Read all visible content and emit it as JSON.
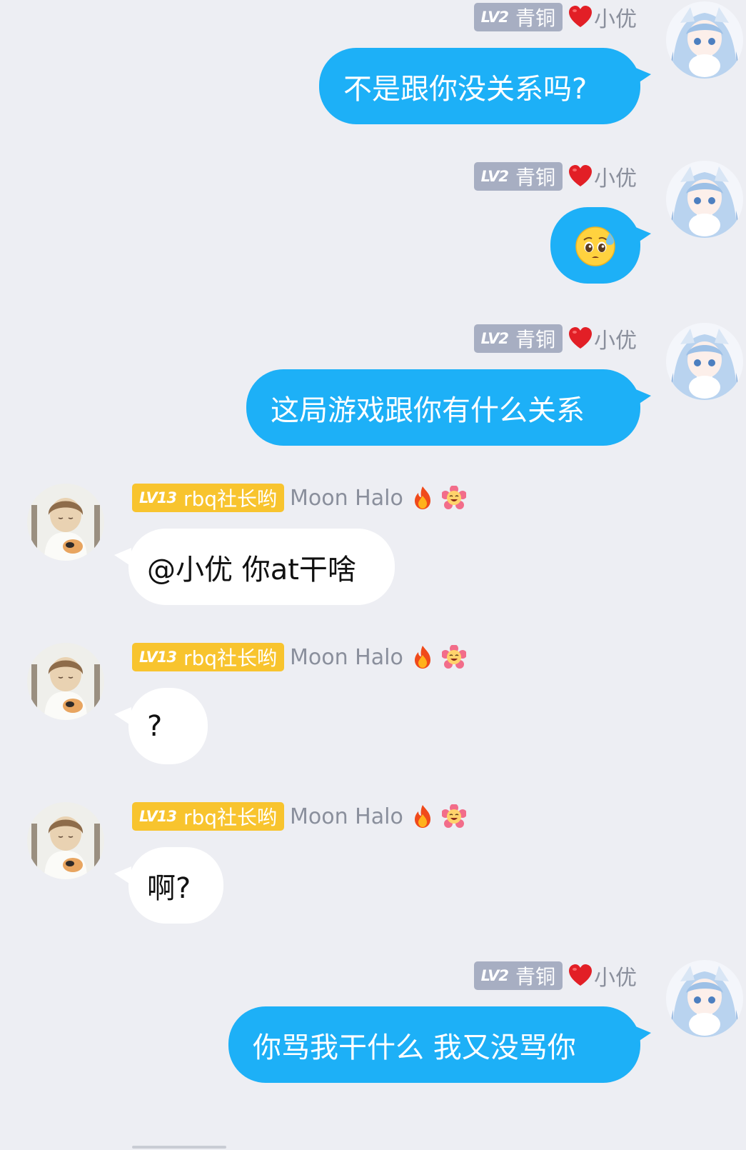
{
  "chat": {
    "messages": [
      {
        "direction": "out",
        "badge_level": "LV2",
        "badge_title": "青铜",
        "heart_icon": "heart-icon",
        "nickname": "小优",
        "text": "不是跟你没关系吗?"
      },
      {
        "direction": "out",
        "badge_level": "LV2",
        "badge_title": "青铜",
        "heart_icon": "heart-icon",
        "nickname": "小优",
        "emoji": "pleading-sweat-face-emoji"
      },
      {
        "direction": "out",
        "badge_level": "LV2",
        "badge_title": "青铜",
        "heart_icon": "heart-icon",
        "nickname": "小优",
        "text": "这局游戏跟你有什么关系"
      },
      {
        "direction": "in",
        "badge_level": "LV13",
        "badge_title": "rbq社长哟",
        "nickname": "Moon Halo",
        "icons": [
          "fire-icon",
          "flower-face-icon"
        ],
        "text": "@小优 你at干啥"
      },
      {
        "direction": "in",
        "badge_level": "LV13",
        "badge_title": "rbq社长哟",
        "nickname": "Moon Halo",
        "icons": [
          "fire-icon",
          "flower-face-icon"
        ],
        "text": "?"
      },
      {
        "direction": "in",
        "badge_level": "LV13",
        "badge_title": "rbq社长哟",
        "nickname": "Moon Halo",
        "icons": [
          "fire-icon",
          "flower-face-icon"
        ],
        "text": "啊?"
      },
      {
        "direction": "out",
        "badge_level": "LV2",
        "badge_title": "青铜",
        "heart_icon": "heart-icon",
        "nickname": "小优",
        "text": "你骂我干什么 我又没骂你"
      }
    ]
  },
  "colors": {
    "background": "#EDEEF3",
    "outgoing_bubble": "#1DB0F7",
    "incoming_bubble": "#FFFFFF",
    "bronze_badge": "#A7AEC2",
    "gold_badge": "#F8C42E",
    "nickname_text": "#8A8F9C"
  }
}
